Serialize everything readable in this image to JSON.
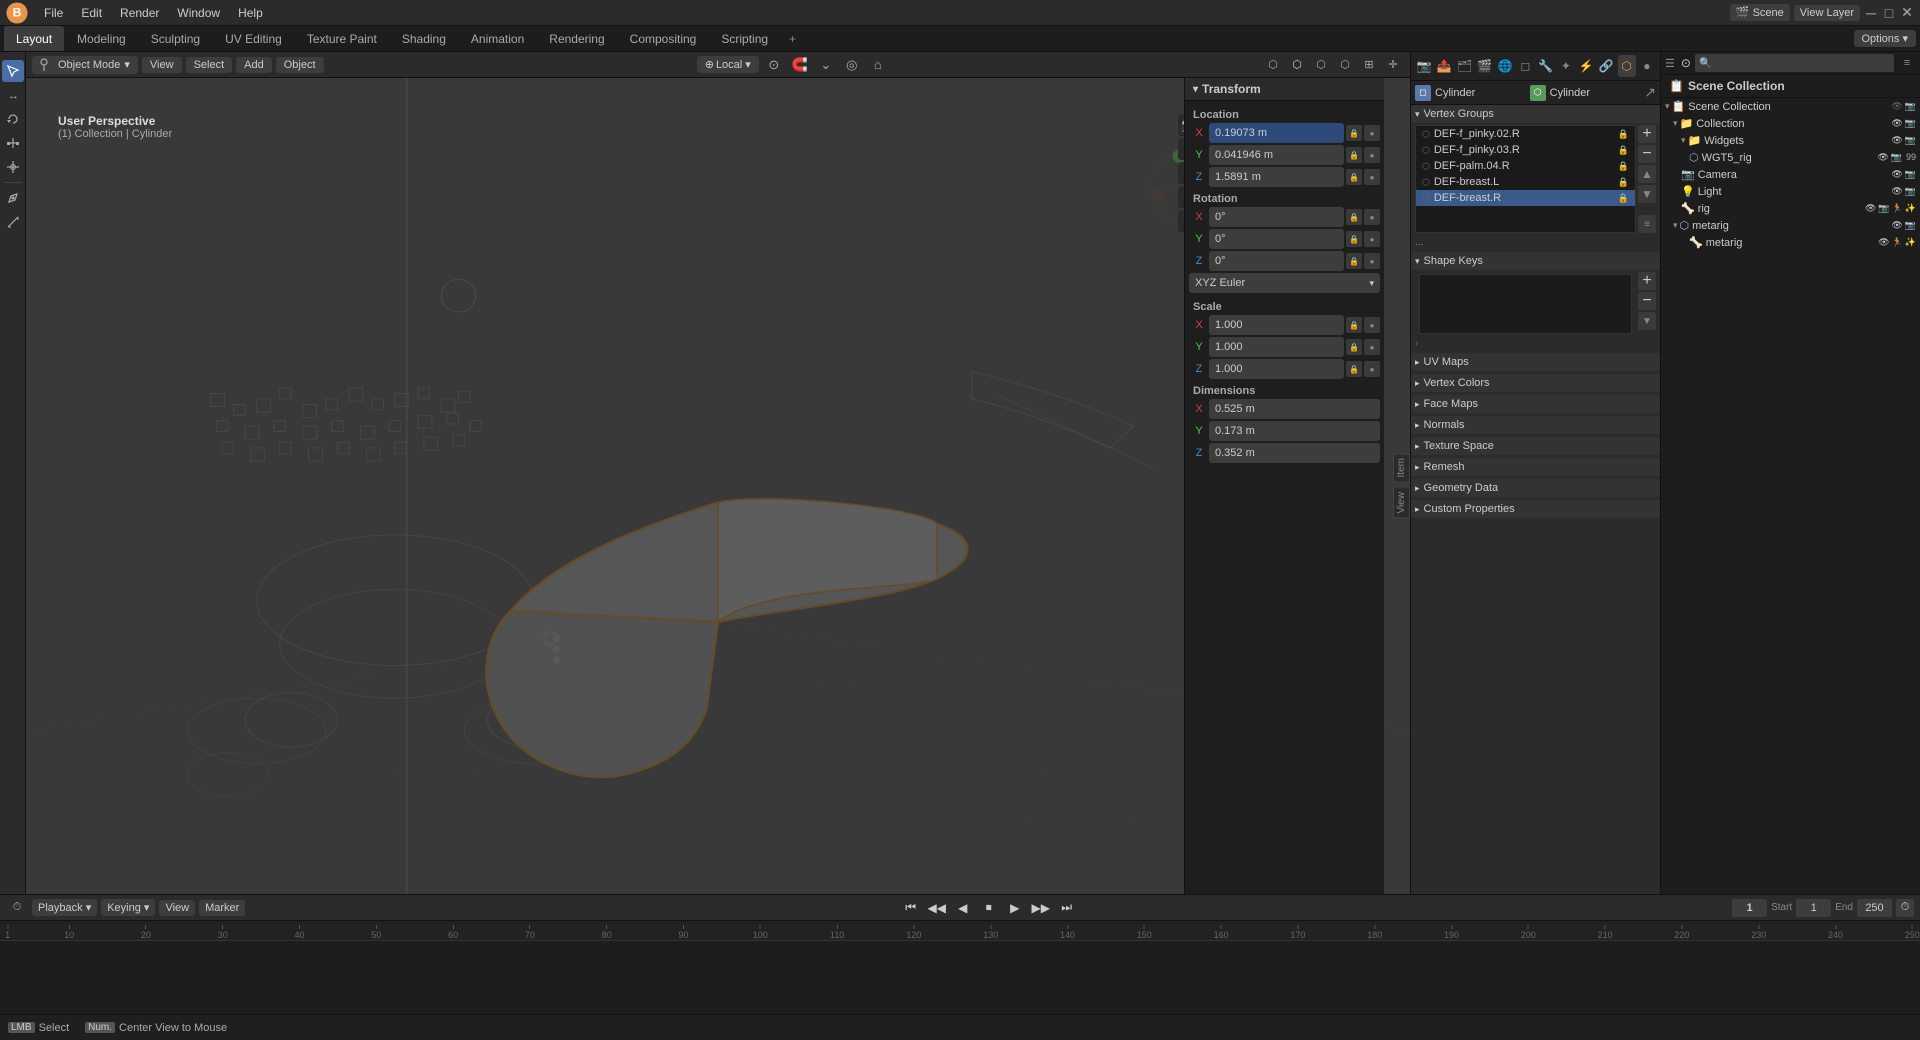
{
  "app": {
    "title": "Blender",
    "logo_color": "#e8954a"
  },
  "top_menu": {
    "items": [
      "File",
      "Edit",
      "Render",
      "Window",
      "Help"
    ]
  },
  "workspace_tabs": {
    "tabs": [
      "Layout",
      "Modeling",
      "Sculpting",
      "UV Editing",
      "Texture Paint",
      "Shading",
      "Animation",
      "Rendering",
      "Compositing",
      "Scripting"
    ],
    "active": "Layout",
    "plus": "+",
    "right_items": [
      "Options ▾"
    ]
  },
  "viewport_header": {
    "mode": "Object Mode",
    "view_btn": "View",
    "select_btn": "Select",
    "add_btn": "Add",
    "object_btn": "Object",
    "perspective_local": "Local",
    "view_type": "User Perspective",
    "collection_path": "(1) Collection | Cylinder"
  },
  "transform_panel": {
    "title": "Transform",
    "location": {
      "label": "Location",
      "x": "0.19073 m",
      "y": "0.041946 m",
      "z": "1.5891 m"
    },
    "rotation": {
      "label": "Rotation",
      "x": "0°",
      "y": "0°",
      "z": "0°",
      "mode": "XYZ Euler"
    },
    "scale": {
      "label": "Scale",
      "x": "1.000",
      "y": "1.000",
      "z": "1.000"
    },
    "dimensions": {
      "label": "Dimensions",
      "x": "0.525 m",
      "y": "0.173 m",
      "z": "0.352 m"
    }
  },
  "scene_collection": {
    "title": "Scene Collection",
    "search_placeholder": "Search...",
    "items": [
      {
        "name": "Collection",
        "type": "collection",
        "level": 0,
        "expanded": true
      },
      {
        "name": "Widgets",
        "type": "collection",
        "level": 1,
        "expanded": true
      },
      {
        "name": "WGT5_rig",
        "type": "object",
        "level": 2
      },
      {
        "name": "Camera",
        "type": "camera",
        "level": 1
      },
      {
        "name": "Light",
        "type": "light",
        "level": 1
      },
      {
        "name": "rig",
        "type": "armature",
        "level": 1
      },
      {
        "name": "metarig",
        "type": "armature",
        "level": 1,
        "expanded": true
      },
      {
        "name": "metarig",
        "type": "armature",
        "level": 2
      }
    ]
  },
  "properties_panel": {
    "title": "Cylinder",
    "object_name": "Cylinder",
    "data_name": "Cylinder",
    "vertex_groups": {
      "title": "Vertex Groups",
      "items": [
        {
          "name": "DEF-f_pinky.02.R",
          "selected": false
        },
        {
          "name": "DEF-f_pinky.03.R",
          "selected": false
        },
        {
          "name": "DEF-palm.04.R",
          "selected": false
        },
        {
          "name": "DEF-breast.L",
          "selected": false
        },
        {
          "name": "DEF-breast.R",
          "selected": true
        }
      ]
    },
    "shape_keys": {
      "title": "Shape Keys"
    },
    "sections": [
      {
        "name": "UV Maps",
        "collapsed": true
      },
      {
        "name": "Vertex Colors",
        "collapsed": true
      },
      {
        "name": "Face Maps",
        "collapsed": true
      },
      {
        "name": "Normals",
        "collapsed": true
      },
      {
        "name": "Texture Space",
        "collapsed": true
      },
      {
        "name": "Remesh",
        "collapsed": true
      },
      {
        "name": "Geometry Data",
        "collapsed": true
      },
      {
        "name": "Custom Properties",
        "collapsed": true
      }
    ]
  },
  "timeline": {
    "playback_label": "Playback",
    "keying_label": "Keying",
    "view_label": "View",
    "marker_label": "Marker",
    "current_frame": "1",
    "start_frame": "1",
    "end_frame": "250",
    "start_label": "Start",
    "end_label": "End",
    "frame_marks": [
      "1",
      "10",
      "20",
      "30",
      "40",
      "50",
      "60",
      "70",
      "80",
      "90",
      "100",
      "110",
      "120",
      "130",
      "140",
      "150",
      "160",
      "170",
      "180",
      "190",
      "200",
      "210",
      "220",
      "230",
      "240",
      "250"
    ]
  },
  "status_bar": {
    "select_label": "Select",
    "center_view_label": "Center View to Mouse"
  },
  "top_right": {
    "scene_label": "Scene",
    "view_layer_label": "View Layer"
  },
  "icons": {
    "cursor": "⊕",
    "move": "↔",
    "rotate": "↺",
    "scale": "⤢",
    "transform": "✛",
    "annotate": "✏",
    "measure": "📐",
    "play": "▶",
    "pause": "⏸",
    "skip_start": "⏮",
    "skip_end": "⏭",
    "step_back": "◀",
    "step_fwd": "▶",
    "jump_start": "⏮",
    "jump_end": "⏭",
    "scene_icon": "🎬",
    "camera_icon": "📷",
    "light_icon": "💡",
    "mesh_icon": "◆",
    "armature_icon": "🦴",
    "collection_icon": "📁"
  }
}
